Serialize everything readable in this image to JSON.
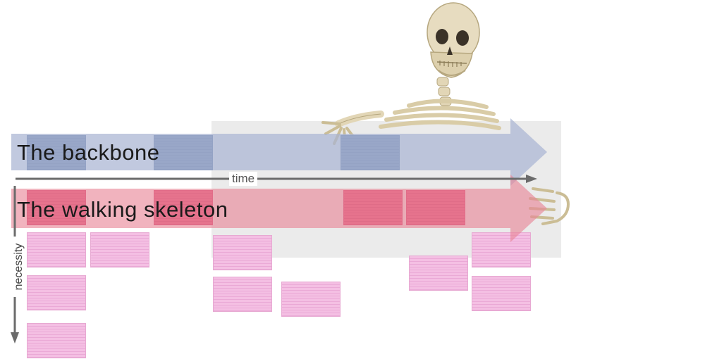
{
  "backbone_label": "The backbone",
  "walking_skeleton_label": "The walking skeleton",
  "time_label": "time",
  "necessity_label": "necessity",
  "colors": {
    "backbone_arrow": "#a9b4d2",
    "skeleton_arrow": "#e88596",
    "backlog_card": "#f4bfe3",
    "backbone_card": "#6f86ad",
    "skeleton_card": "#e3577f",
    "axis": "#6b6b6b"
  },
  "icons": {
    "skeleton_head": "skull-icon",
    "skeleton_left_hand": "bony-hand-icon",
    "skeleton_right_hand": "bony-hand-icon"
  }
}
